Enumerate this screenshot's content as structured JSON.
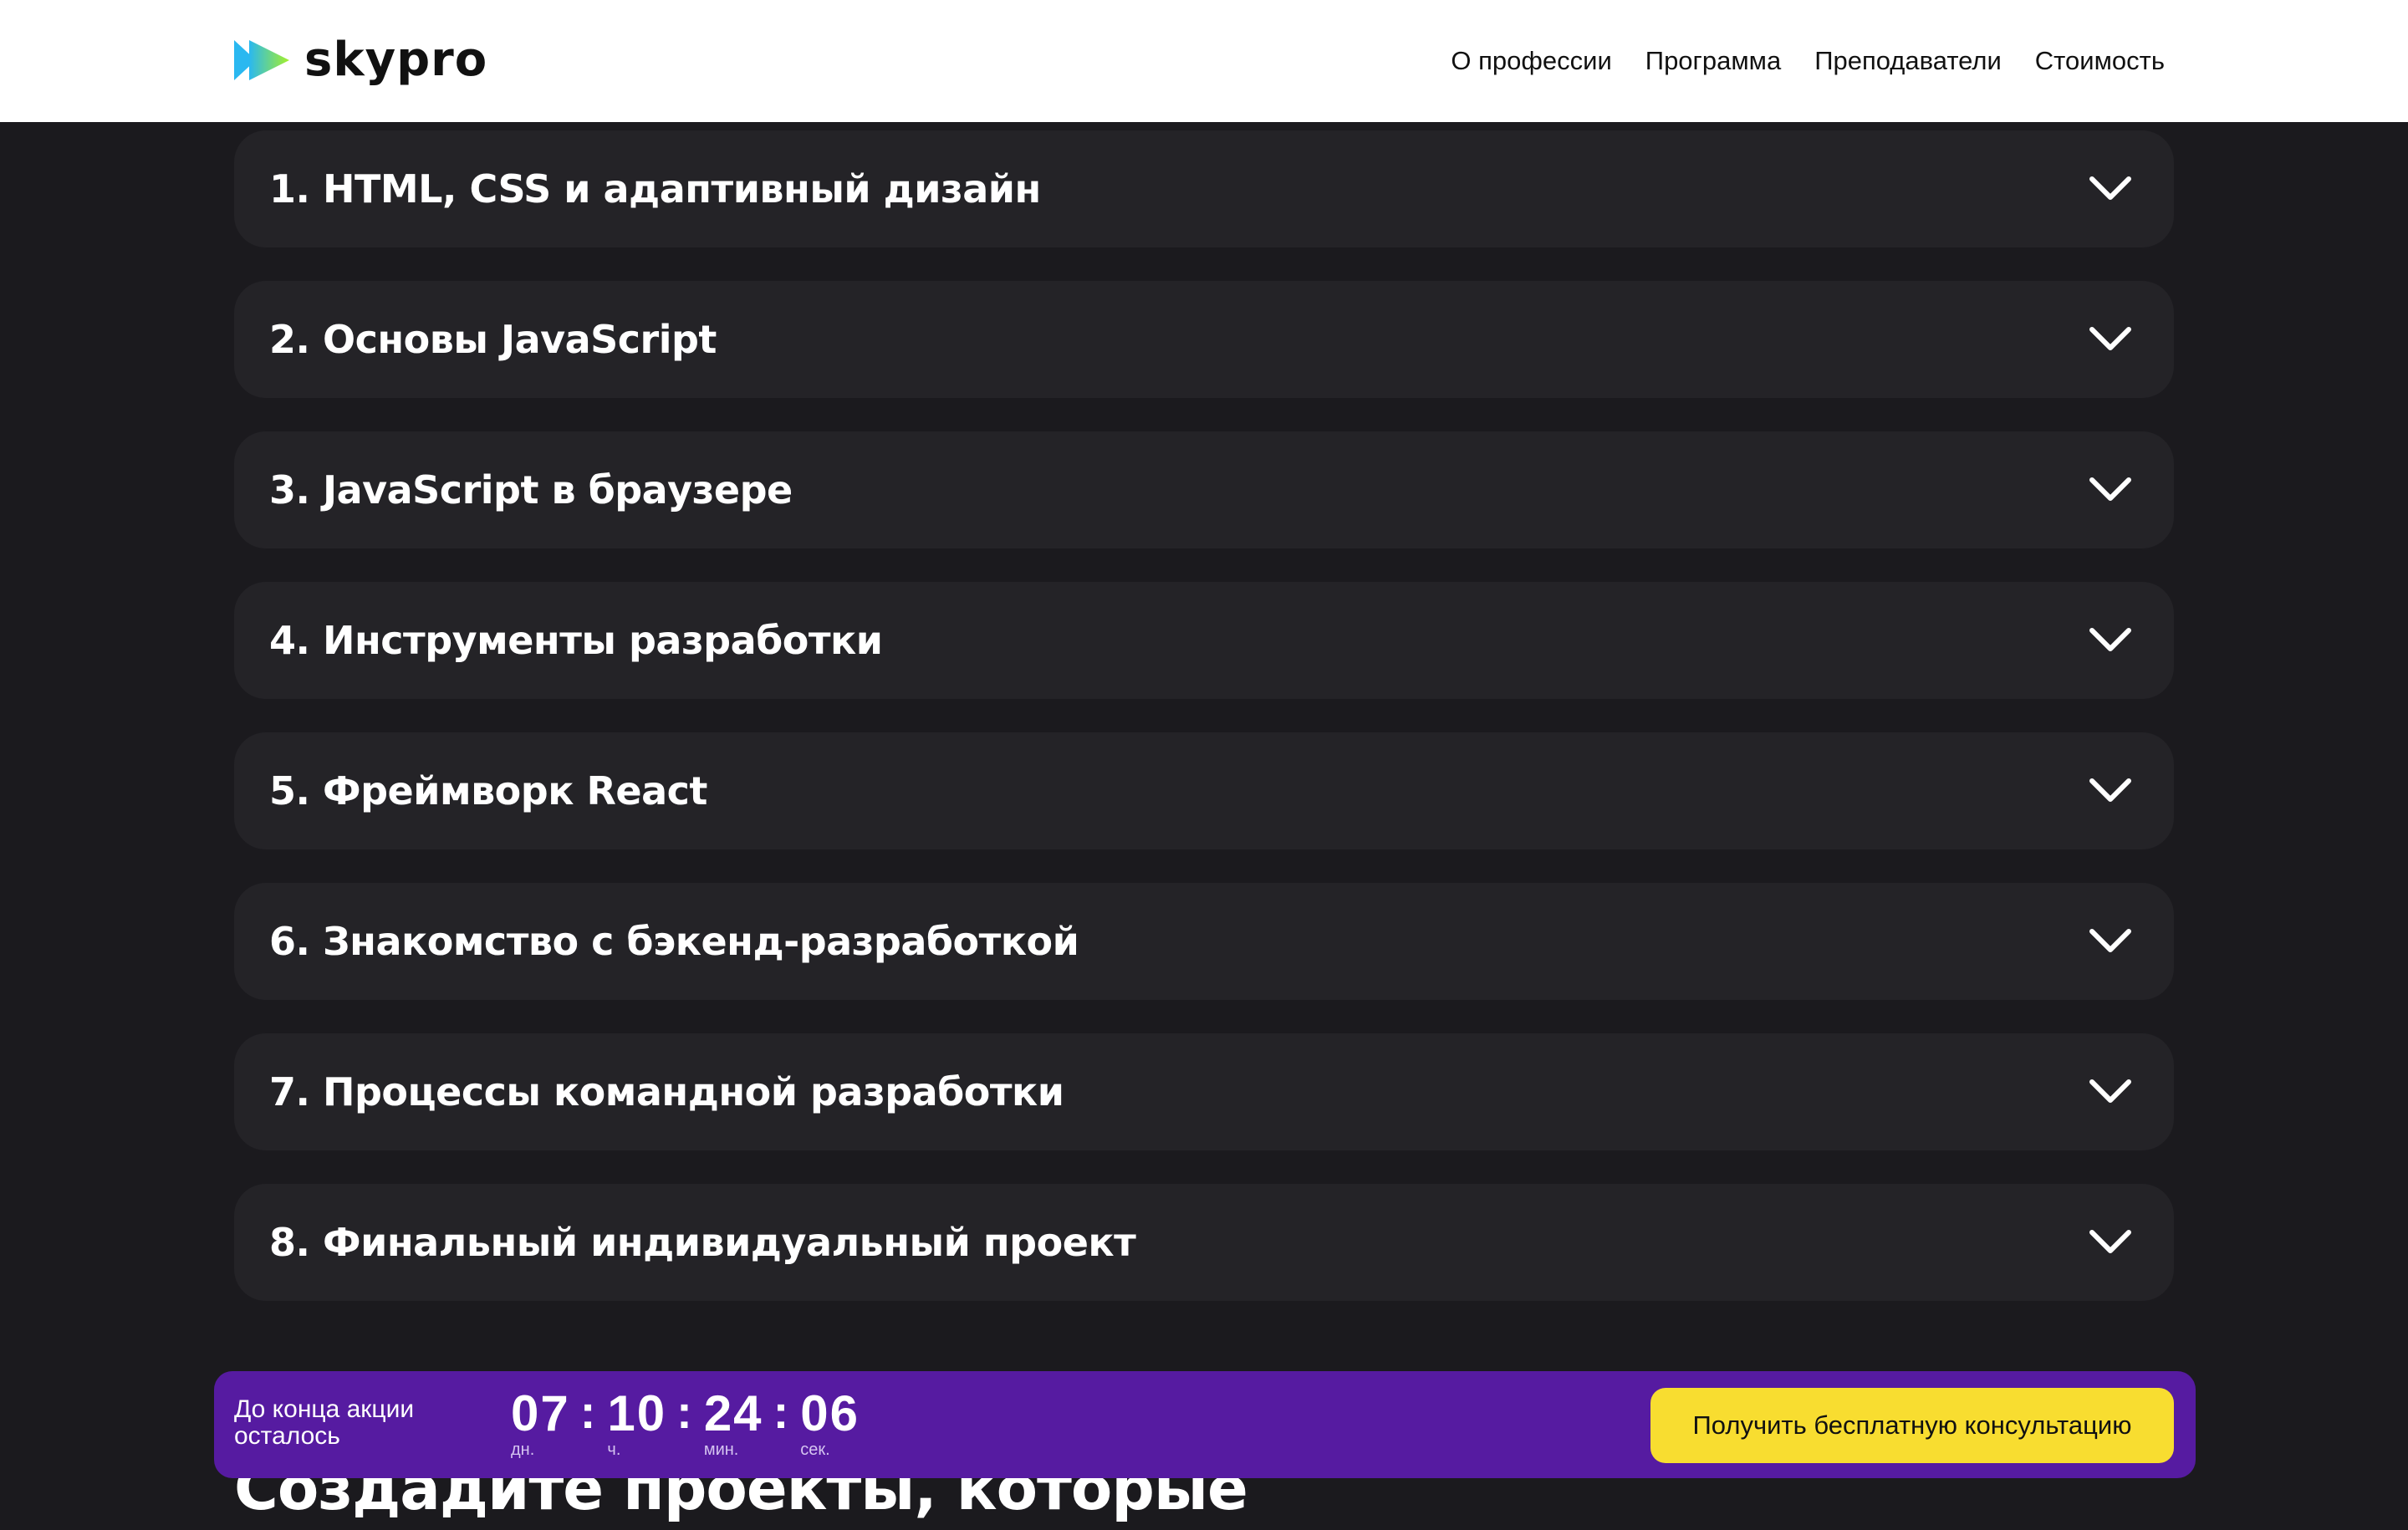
{
  "header": {
    "logo_text": "skypro",
    "nav": [
      {
        "label": "О профессии"
      },
      {
        "label": "Программа"
      },
      {
        "label": "Преподаватели"
      },
      {
        "label": "Стоимость"
      }
    ]
  },
  "program": {
    "items": [
      {
        "title": "1. HTML, CSS и адаптивный дизайн"
      },
      {
        "title": "2. Основы JavaScript"
      },
      {
        "title": "3. JavaScript в браузере"
      },
      {
        "title": "4. Инструменты разработки"
      },
      {
        "title": "5. Фреймворк React"
      },
      {
        "title": "6. Знакомство с бэкенд-разработкой"
      },
      {
        "title": "7. Процессы командной разработки"
      },
      {
        "title": "8. Финальный индивидуальный проект"
      }
    ]
  },
  "section": {
    "heading": "Создадите проекты, которые"
  },
  "promo": {
    "label": "До конца акции осталось",
    "timer": {
      "days": "07",
      "days_unit": "дн.",
      "hours": "10",
      "hours_unit": "ч.",
      "minutes": "24",
      "minutes_unit": "мин.",
      "seconds": "06",
      "seconds_unit": "сек.",
      "separator": ":"
    },
    "cta_label": "Получить бесплатную консультацию"
  },
  "colors": {
    "background": "#1b1a1e",
    "card": "#242327",
    "header_bg": "#ffffff",
    "promo_bg": "#561ba1",
    "cta_bg": "#f8dd30",
    "logo_gradient_start": "#2ab8f0",
    "logo_gradient_end": "#a5f02a"
  },
  "icons": {
    "accordion": "chevron-down-icon",
    "logo": "skypro-play-icon"
  }
}
